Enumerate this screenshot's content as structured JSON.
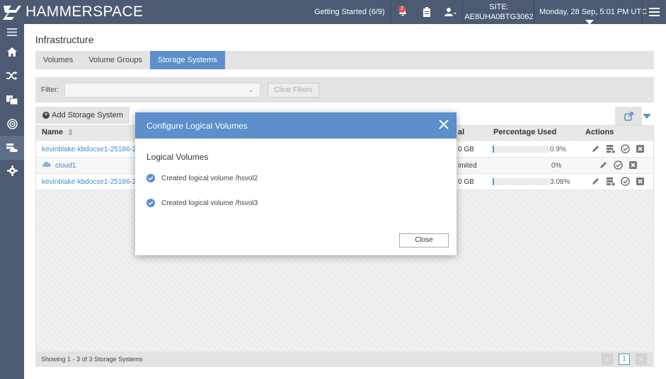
{
  "app": {
    "name": "HAMMERSPACE"
  },
  "topbar": {
    "getting_started": "Getting Started (6/9)",
    "notification_count": "2",
    "site_label": "SITE:",
    "site_id": "AE8UHA0BTG3062",
    "datetime": "Monday, 28 Sep, 5:01 PM UTC"
  },
  "sidebar": {
    "items": [
      {
        "icon": "menu-icon"
      },
      {
        "icon": "home-icon"
      },
      {
        "icon": "shuffle-icon"
      },
      {
        "icon": "files-icon"
      },
      {
        "icon": "target-icon"
      },
      {
        "icon": "storage-cloud-icon",
        "active": true
      },
      {
        "icon": "gear-icon"
      }
    ]
  },
  "page": {
    "title": "Infrastructure",
    "tabs": [
      {
        "label": "Volumes"
      },
      {
        "label": "Volume Groups"
      },
      {
        "label": "Storage Systems",
        "active": true
      }
    ],
    "filter_label": "Filter:",
    "clear_filters": "Clear Filters",
    "add_button": "Add Storage System"
  },
  "grid": {
    "columns": {
      "name": "Name",
      "total": "al",
      "pct_used": "Percentage Used",
      "actions": "Actions"
    },
    "rows": [
      {
        "name": "kevinblake-kbdocse1-25186-2",
        "total": "0 GB",
        "pct": "0.9%",
        "fill": 0.009
      },
      {
        "name": "cloud1",
        "total": "imited",
        "pct": "0%",
        "fill": 0
      },
      {
        "name": "kevinblake-kbdocse1-25186-2",
        "total": "0 GB",
        "pct": "3.08%",
        "fill": 0.0308
      }
    ],
    "footer": "Showing 1 - 3 of 3 Storage Systems",
    "page": "1"
  },
  "modal": {
    "title": "Configure Logical Volumes",
    "subtitle": "Logical Volumes",
    "lines": [
      "Created logical volume /hsvol2",
      "Created logical volume /hsvol3"
    ],
    "close_button": "Close"
  },
  "colors": {
    "nav": "#4c5a72",
    "accent": "#5c8fcb",
    "link": "#4a8ac9"
  }
}
